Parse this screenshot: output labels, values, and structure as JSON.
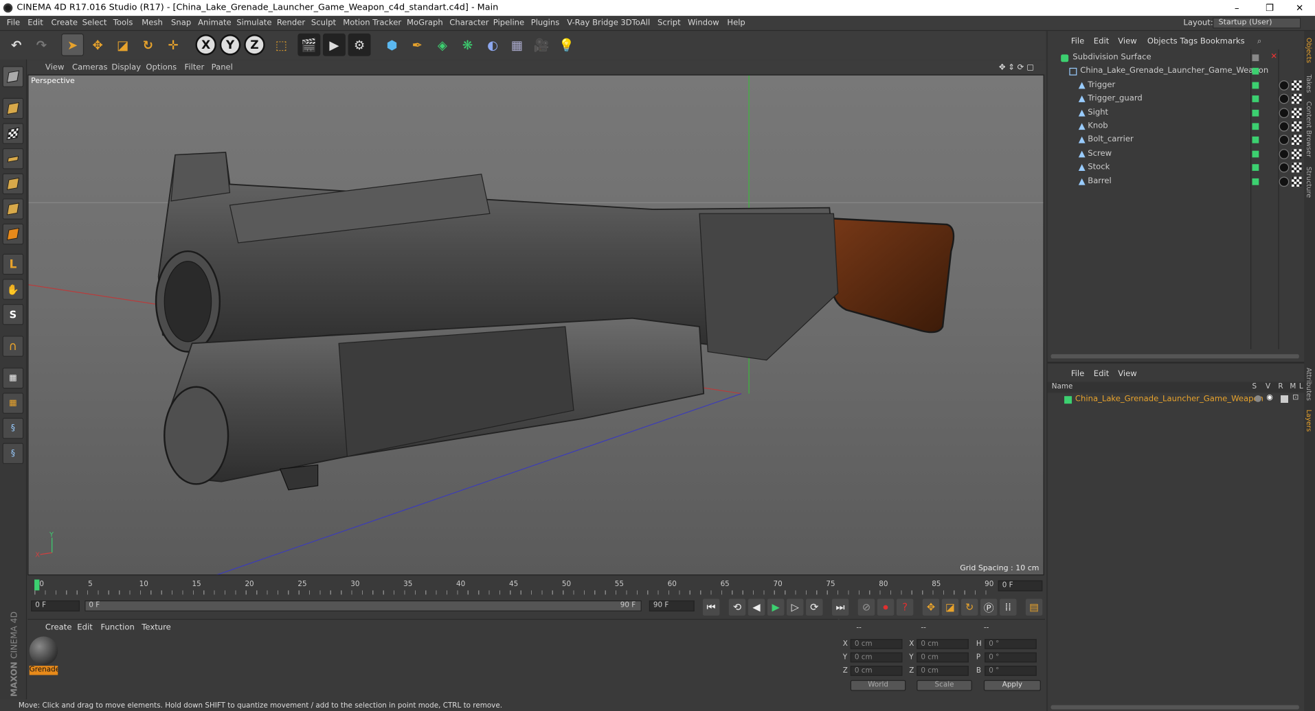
{
  "window": {
    "title": "CINEMA 4D R17.016 Studio (R17) - [China_Lake_Grenade_Launcher_Game_Weapon_c4d_standart.c4d] - Main",
    "minimize": "–",
    "restore": "❐",
    "close": "✕"
  },
  "menubar": {
    "items": [
      "File",
      "Edit",
      "Create",
      "Select",
      "Tools",
      "Mesh",
      "Snap",
      "Animate",
      "Simulate",
      "Render",
      "Sculpt",
      "Motion Tracker",
      "MoGraph",
      "Character",
      "Pipeline",
      "Plugins",
      "V-Ray Bridge",
      "3DToAll",
      "Script",
      "Window",
      "Help"
    ],
    "layout_label": "Layout:",
    "layout_value": "Startup (User)"
  },
  "toolbar": {
    "icons": [
      "undo-icon",
      "redo-icon",
      "select-arrow-icon",
      "move-icon",
      "scale-icon",
      "rotate-icon",
      "move-add-icon",
      "x-axis-icon",
      "y-axis-icon",
      "z-axis-icon",
      "world-coord-icon",
      "render-view-icon",
      "render-picture-viewer-icon",
      "render-settings-icon",
      "cube-icon",
      "pen-icon",
      "subdivision-icon",
      "array-icon",
      "deformer-icon",
      "floor-icon",
      "camera-icon",
      "light-icon"
    ],
    "axis_x": "X",
    "axis_y": "Y",
    "axis_z": "Z"
  },
  "viewport": {
    "menu": [
      "View",
      "Cameras",
      "Display",
      "Options",
      "Filter",
      "Panel"
    ],
    "label": "Perspective",
    "grid_spacing": "Grid Spacing : 10 cm",
    "axis_y": "Y",
    "axis_x": "X",
    "axis_z": "Z"
  },
  "timeline": {
    "ticks": [
      "0",
      "5",
      "10",
      "15",
      "20",
      "25",
      "30",
      "35",
      "40",
      "45",
      "50",
      "55",
      "60",
      "65",
      "70",
      "75",
      "80",
      "85",
      "90"
    ],
    "current_frame": "0 F",
    "start_frame": "0 F",
    "range_start": "0 F",
    "range_end": "90 F",
    "end_frame": "90 F"
  },
  "material_panel": {
    "menu": [
      "Create",
      "Edit",
      "Function",
      "Texture"
    ],
    "material_name": "Grenade"
  },
  "coordinates": {
    "header": [
      "--",
      "--",
      "--"
    ],
    "rows": [
      {
        "l1": "X",
        "v1": "0 cm",
        "l2": "X",
        "v2": "0 cm",
        "l3": "H",
        "v3": "0 °"
      },
      {
        "l1": "Y",
        "v1": "0 cm",
        "l2": "Y",
        "v2": "0 cm",
        "l3": "P",
        "v3": "0 °"
      },
      {
        "l1": "Z",
        "v1": "0 cm",
        "l2": "Z",
        "v2": "0 cm",
        "l3": "B",
        "v3": "0 °"
      }
    ],
    "world": "World",
    "scale": "Scale",
    "apply": "Apply"
  },
  "status": "Move: Click and drag to move elements. Hold down SHIFT to quantize movement / add to the selection in point mode, CTRL to remove.",
  "objects_panel": {
    "menu": [
      "File",
      "Edit",
      "View",
      "Objects",
      "Tags",
      "Bookmarks"
    ],
    "root": "Subdivision Surface",
    "group": "China_Lake_Grenade_Launcher_Game_Weapon",
    "children": [
      "Trigger",
      "Trigger_guard",
      "Sight",
      "Knob",
      "Bolt_carrier",
      "Screw",
      "Stock",
      "Barrel"
    ]
  },
  "layers_panel": {
    "menu": [
      "File",
      "Edit",
      "View"
    ],
    "col_name": "Name",
    "cols": [
      "S",
      "V",
      "R",
      "M",
      "L"
    ],
    "layer": "China_Lake_Grenade_Launcher_Game_Weapon"
  },
  "side_tabs": [
    "Objects",
    "Takes",
    "Content Browser",
    "Structure",
    "Attributes",
    "Layers"
  ],
  "brand": {
    "line1": "MAXON",
    "line2": "CINEMA 4D"
  },
  "colors": {
    "accent": "#e88a1a",
    "green": "#3cd070",
    "bg": "#3a3a3a"
  }
}
